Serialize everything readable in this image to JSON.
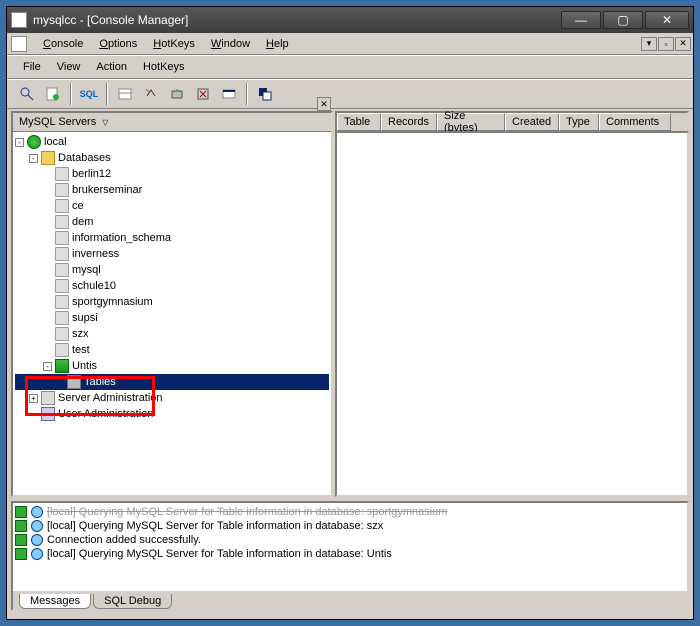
{
  "window": {
    "title": "mysqlcc - [Console Manager]"
  },
  "menu1": {
    "console": "Console",
    "options": "Options",
    "hotkeys": "HotKeys",
    "window": "Window",
    "help": "Help"
  },
  "menu2": {
    "file": "File",
    "view": "View",
    "action": "Action",
    "hotkeys": "HotKeys"
  },
  "tree_header": "MySQL Servers",
  "tree": {
    "server": "local",
    "databases_label": "Databases",
    "dbs": [
      "berlin12",
      "brukerseminar",
      "ce",
      "dem",
      "information_schema",
      "inverness",
      "mysql",
      "schule10",
      "sportgymnasium",
      "supsi",
      "szx",
      "test"
    ],
    "untis": {
      "label": "Untis",
      "tables": "Tables"
    },
    "server_admin": "Server Administration",
    "user_admin": "User Administration"
  },
  "columns": {
    "table": "Table",
    "records": "Records",
    "size": "Size (bytes)",
    "created": "Created",
    "type": "Type",
    "comments": "Comments"
  },
  "log": {
    "l0": "[local] Querying MySQL Server for Table information in database: sportgymnasium",
    "l1": "[local] Querying MySQL Server for Table information in database: szx",
    "l2": "Connection added successfully.",
    "l3": "[local] Querying MySQL Server for Table information in database: Untis"
  },
  "tabs": {
    "messages": "Messages",
    "debug": "SQL Debug"
  }
}
